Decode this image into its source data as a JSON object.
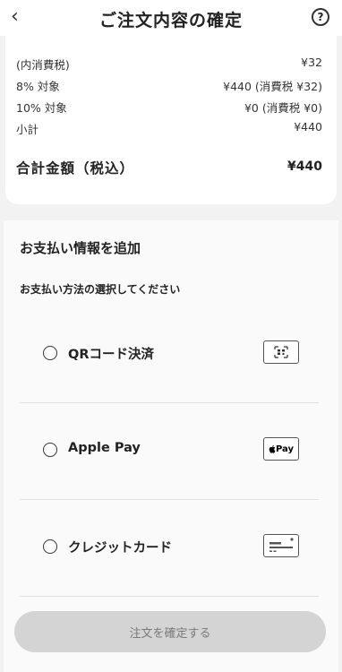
{
  "header": {
    "back_icon": "‹",
    "title": "ご注文内容の確定",
    "help_icon": "?"
  },
  "summary": {
    "rows": [
      {
        "label": "(内消費税)",
        "value": "¥32"
      },
      {
        "label": "8% 対象",
        "value": "¥440 (消費税 ¥32)"
      },
      {
        "label": "10% 対象",
        "value": "¥0 (消費税 ¥0)"
      },
      {
        "label": "小計",
        "value": "¥440"
      }
    ],
    "total_label": "合計金額（税込）",
    "total_value": "¥440"
  },
  "payment": {
    "title": "お支払い情報を追加",
    "subtitle": "お支払い方法の選択してください",
    "options": [
      {
        "label": "QRコード決済",
        "icon": "qr-code-icon",
        "selected": false
      },
      {
        "label": "Apple Pay",
        "icon": "apple-pay-icon",
        "icon_text": "Pay",
        "selected": false
      },
      {
        "label": "クレジットカード",
        "icon": "credit-card-icon",
        "selected": false
      }
    ]
  },
  "confirm_button": {
    "label": "注文を確定する",
    "enabled": false
  },
  "colors": {
    "background": "#f2f2f2",
    "card": "#ffffff",
    "button_disabled": "#d4d4d4",
    "button_text_disabled": "#7a7a7a"
  }
}
